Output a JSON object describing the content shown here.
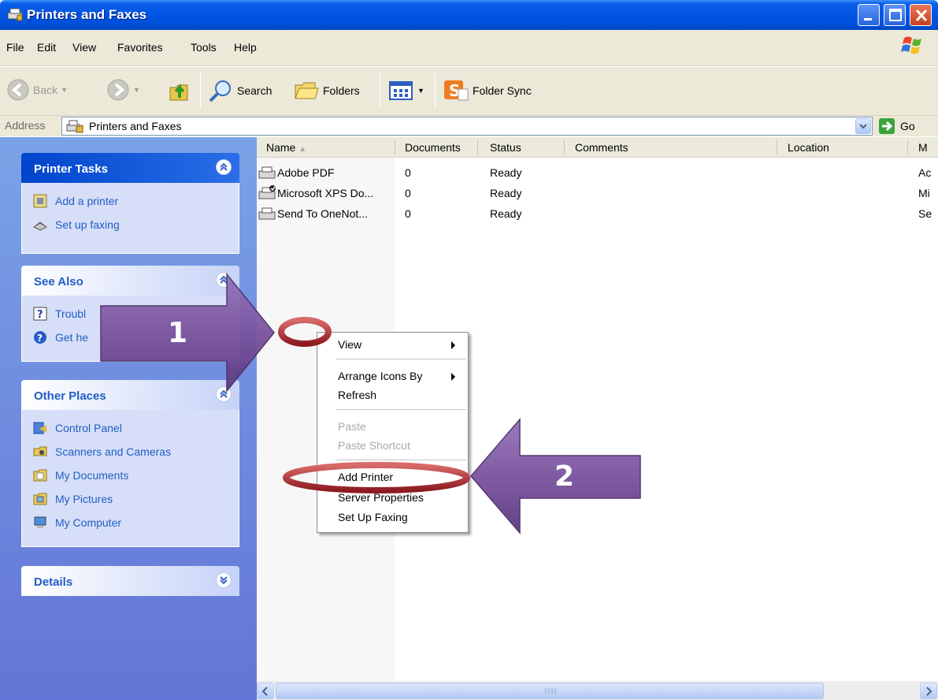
{
  "window": {
    "title": "Printers and Faxes"
  },
  "menu": [
    "File",
    "Edit",
    "View",
    "Favorites",
    "Tools",
    "Help"
  ],
  "toolbar": {
    "back": "Back",
    "search": "Search",
    "folders": "Folders",
    "folder_sync": "Folder Sync"
  },
  "address": {
    "label": "Address",
    "value": "Printers and Faxes",
    "go": "Go"
  },
  "sidebar": {
    "printer_tasks": {
      "title": "Printer Tasks",
      "items": [
        "Add a printer",
        "Set up faxing"
      ]
    },
    "see_also": {
      "title": "See Also",
      "items": [
        "Troubl",
        "Get he"
      ]
    },
    "other_places": {
      "title": "Other Places",
      "items": [
        "Control Panel",
        "Scanners and Cameras",
        "My Documents",
        "My Pictures",
        "My Computer"
      ]
    },
    "details": {
      "title": "Details"
    }
  },
  "list": {
    "columns": [
      "Name",
      "Documents",
      "Status",
      "Comments",
      "Location",
      "M"
    ],
    "rows": [
      {
        "name": "Adobe PDF",
        "documents": "0",
        "status": "Ready",
        "model": "Ac"
      },
      {
        "name": "Microsoft XPS Do...",
        "documents": "0",
        "status": "Ready",
        "model": "Mi"
      },
      {
        "name": "Send To OneNot...",
        "documents": "0",
        "status": "Ready",
        "model": "Se"
      }
    ]
  },
  "context_menu": {
    "view": "View",
    "arrange": "Arrange Icons By",
    "refresh": "Refresh",
    "paste": "Paste",
    "paste_shortcut": "Paste Shortcut",
    "add_printer": "Add Printer",
    "server_properties": "Server Properties",
    "set_up_faxing": "Set Up Faxing"
  },
  "annotations": {
    "step1": "1",
    "step2": "2"
  },
  "colors": {
    "titlebar": "#0054e3",
    "sidebar_bg": "#7ba2e7",
    "task_link": "#215dc6",
    "arrow_fill": "#7e57a3",
    "highlight_ring": "#b0232c"
  }
}
